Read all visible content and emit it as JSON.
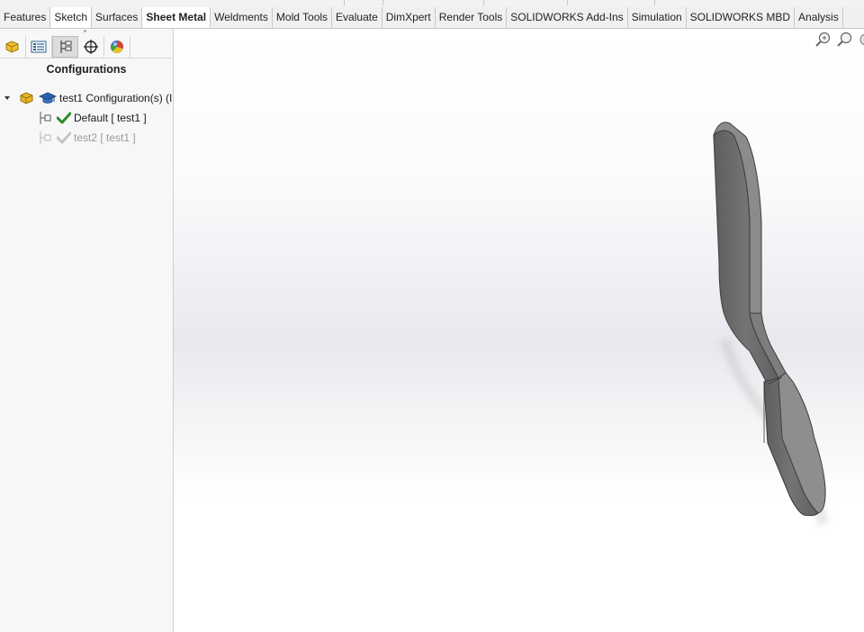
{
  "tabs": [
    {
      "label": "Features",
      "active": false
    },
    {
      "label": "Sketch",
      "active": false
    },
    {
      "label": "Surfaces",
      "active": false
    },
    {
      "label": "Sheet Metal",
      "active": true
    },
    {
      "label": "Weldments",
      "active": false
    },
    {
      "label": "Mold Tools",
      "active": false
    },
    {
      "label": "Evaluate",
      "active": false
    },
    {
      "label": "DimXpert",
      "active": false
    },
    {
      "label": "Render Tools",
      "active": false
    },
    {
      "label": "SOLIDWORKS Add-Ins",
      "active": false
    },
    {
      "label": "Simulation",
      "active": false
    },
    {
      "label": "SOLIDWORKS MBD",
      "active": false
    },
    {
      "label": "Analysis",
      "active": false
    }
  ],
  "manager_tabs": [
    {
      "icon": "featuremanager-icon",
      "active": false
    },
    {
      "icon": "propertymanager-icon",
      "active": false
    },
    {
      "icon": "configurationmanager-icon",
      "active": true
    },
    {
      "icon": "dimxpertmanager-icon",
      "active": false
    },
    {
      "icon": "displaymanager-icon",
      "active": false
    }
  ],
  "pane": {
    "title": "Configurations",
    "tree": {
      "root_label": "test1 Configuration(s)  (I",
      "items": [
        {
          "label": "Default [ test1 ]",
          "active": true
        },
        {
          "label": "test2 [ test1 ]",
          "active": false
        }
      ]
    }
  },
  "viewport": {
    "tools": [
      "zoom-to-fit-icon",
      "zoom-to-area-icon",
      "previous-view-icon"
    ]
  },
  "colors": {
    "model_face": "#6b6b6b",
    "model_edge": "#4a4a4a",
    "check_active": "#2e8b2e",
    "check_inactive": "#b8b8b8",
    "part_icon": "#e8b424"
  }
}
